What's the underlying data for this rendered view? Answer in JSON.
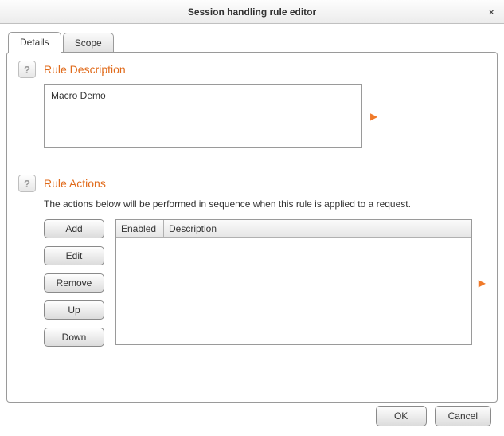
{
  "titlebar": {
    "title": "Session handling rule editor",
    "close": "×"
  },
  "tabs": {
    "details": "Details",
    "scope": "Scope"
  },
  "rule_description": {
    "title": "Rule Description",
    "value": "Macro Demo",
    "help": "?"
  },
  "rule_actions": {
    "title": "Rule Actions",
    "help_text": "The actions below will be performed in sequence when this rule is applied to a request.",
    "help": "?",
    "buttons": {
      "add": "Add",
      "edit": "Edit",
      "remove": "Remove",
      "up": "Up",
      "down": "Down"
    },
    "columns": {
      "enabled": "Enabled",
      "description": "Description"
    }
  },
  "footer": {
    "ok": "OK",
    "cancel": "Cancel"
  }
}
